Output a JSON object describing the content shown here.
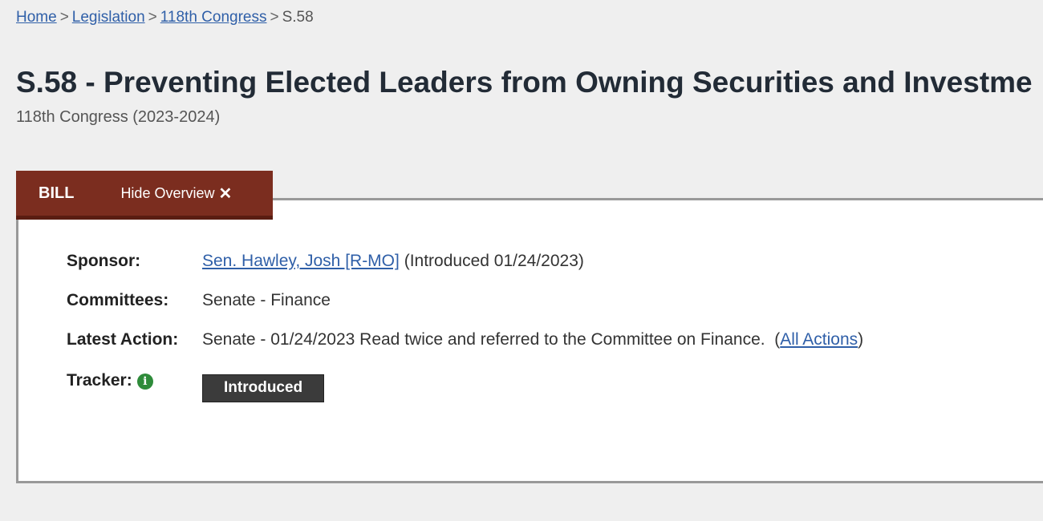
{
  "breadcrumb": {
    "items": [
      "Home",
      "Legislation",
      "118th Congress"
    ],
    "current": "S.58",
    "separator": ">"
  },
  "bill": {
    "title": "S.58 - Preventing Elected Leaders from Owning Securities and Investme",
    "congress": "118th Congress (2023-2024)"
  },
  "tabs": {
    "bill_label": "BILL",
    "hide_overview_label": "Hide Overview",
    "close_icon": "close-icon"
  },
  "overview": {
    "sponsor_label": "Sponsor:",
    "sponsor_name": "Sen. Hawley, Josh [R-MO]",
    "sponsor_intro": "(Introduced 01/24/2023)",
    "committees_label": "Committees:",
    "committees_value": "Senate - Finance",
    "latest_action_label": "Latest Action:",
    "latest_action_text": "Senate - 01/24/2023 Read twice and referred to the Committee on Finance.",
    "all_actions_link": "All Actions",
    "tracker_label": "Tracker:",
    "tracker_icon": "info-icon",
    "tracker_status": "Introduced"
  },
  "colors": {
    "tab_background": "#7b2d1f",
    "link": "#2f5fa8",
    "status_badge": "#3b3b3b",
    "info_icon": "#2e8b3a"
  }
}
